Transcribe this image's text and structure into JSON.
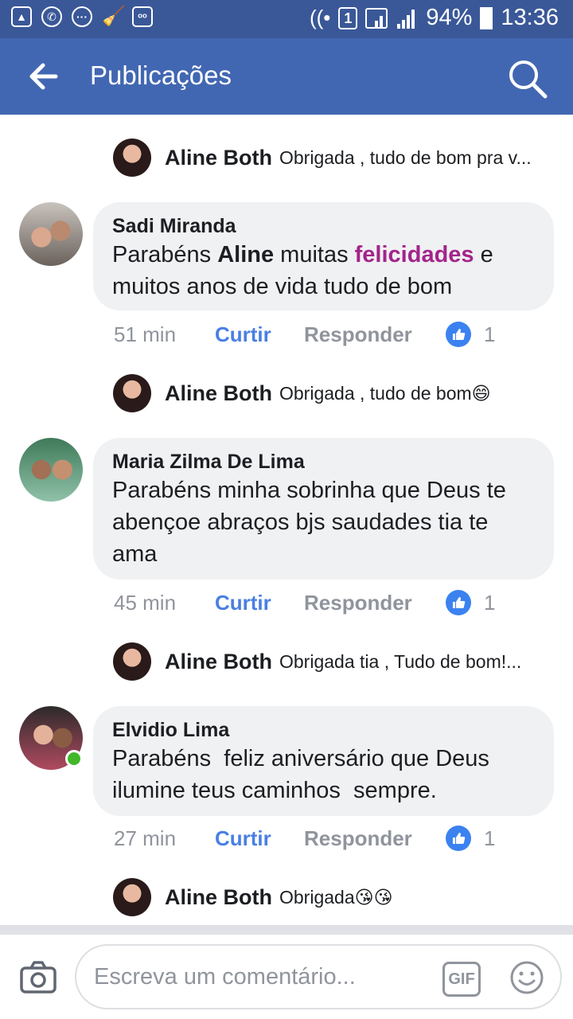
{
  "status_bar": {
    "battery": "94%",
    "time": "13:36",
    "sim_slot": "1",
    "colors": {
      "bg": "#3a5898"
    }
  },
  "header": {
    "title": "Publicações",
    "back_icon": "arrow-left-icon",
    "search_icon": "search-icon",
    "color": "#4267b2"
  },
  "replies": [
    {
      "name": "Aline Both",
      "text": "Obrigada , tudo de bom pra v..."
    },
    {
      "name": "Aline Both",
      "text": "Obrigada , tudo de bom😄"
    },
    {
      "name": "Aline Both",
      "text": "Obrigada tia , Tudo de bom!..."
    },
    {
      "name": "Aline Both",
      "text": "Obrigada😘😘"
    }
  ],
  "comments": [
    {
      "name": "Sadi Miranda",
      "text_parts": [
        "Parabéns ",
        "Aline",
        " muitas ",
        "felicidades",
        " e muitos anos de vida tudo de bom"
      ],
      "time": "51 min",
      "like_label": "Curtir",
      "reply_label": "Responder",
      "likes": "1"
    },
    {
      "name": "Maria Zilma De Lima",
      "text": "Parabéns minha sobrinha que Deus te abençoe abraços bjs saudades tia te ama",
      "time": "45 min",
      "like_label": "Curtir",
      "reply_label": "Responder",
      "likes": "1"
    },
    {
      "name": "Elvidio Lima",
      "text": "Parabéns  feliz aniversário que Deus ilumine teus caminhos  sempre.",
      "time": "27 min",
      "like_label": "Curtir",
      "reply_label": "Responder",
      "likes": "1",
      "online": true
    }
  ],
  "composer": {
    "placeholder": "Escreva um comentário...",
    "gif_label": "GIF",
    "camera_icon": "camera-icon",
    "emoji_icon": "emoji-icon"
  }
}
